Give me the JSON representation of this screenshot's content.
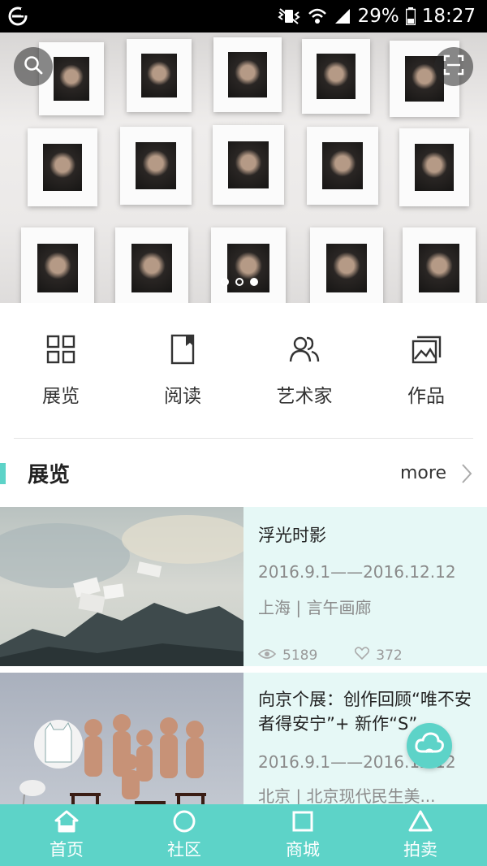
{
  "status_bar": {
    "battery": "29%",
    "time": "18:27"
  },
  "hero": {
    "carousel_total": 3,
    "carousel_active": 3
  },
  "quick_nav": [
    {
      "label": "展览",
      "icon": "grid-icon"
    },
    {
      "label": "阅读",
      "icon": "book-icon"
    },
    {
      "label": "艺术家",
      "icon": "people-icon"
    },
    {
      "label": "作品",
      "icon": "gallery-icon"
    }
  ],
  "section": {
    "title": "展览",
    "more": "more"
  },
  "exhibitions": [
    {
      "title": "浮光时影",
      "date": "2016.9.1——2016.12.12",
      "location": "上海 | 言午画廊",
      "views": "5189",
      "likes": "372"
    },
    {
      "title": "向京个展：创作回顾“唯不安者得安宁”+ 新作“S”",
      "date": "2016.9.1——2016.12.12",
      "location": "北京 | 北京现代民生美..."
    }
  ],
  "tab_bar": [
    {
      "label": "首页",
      "icon": "home-icon"
    },
    {
      "label": "社区",
      "icon": "circle-icon"
    },
    {
      "label": "商城",
      "icon": "square-icon"
    },
    {
      "label": "拍卖",
      "icon": "triangle-icon"
    }
  ],
  "colors": {
    "accent": "#5dd3c8",
    "card_bg": "#e6f8f6"
  }
}
